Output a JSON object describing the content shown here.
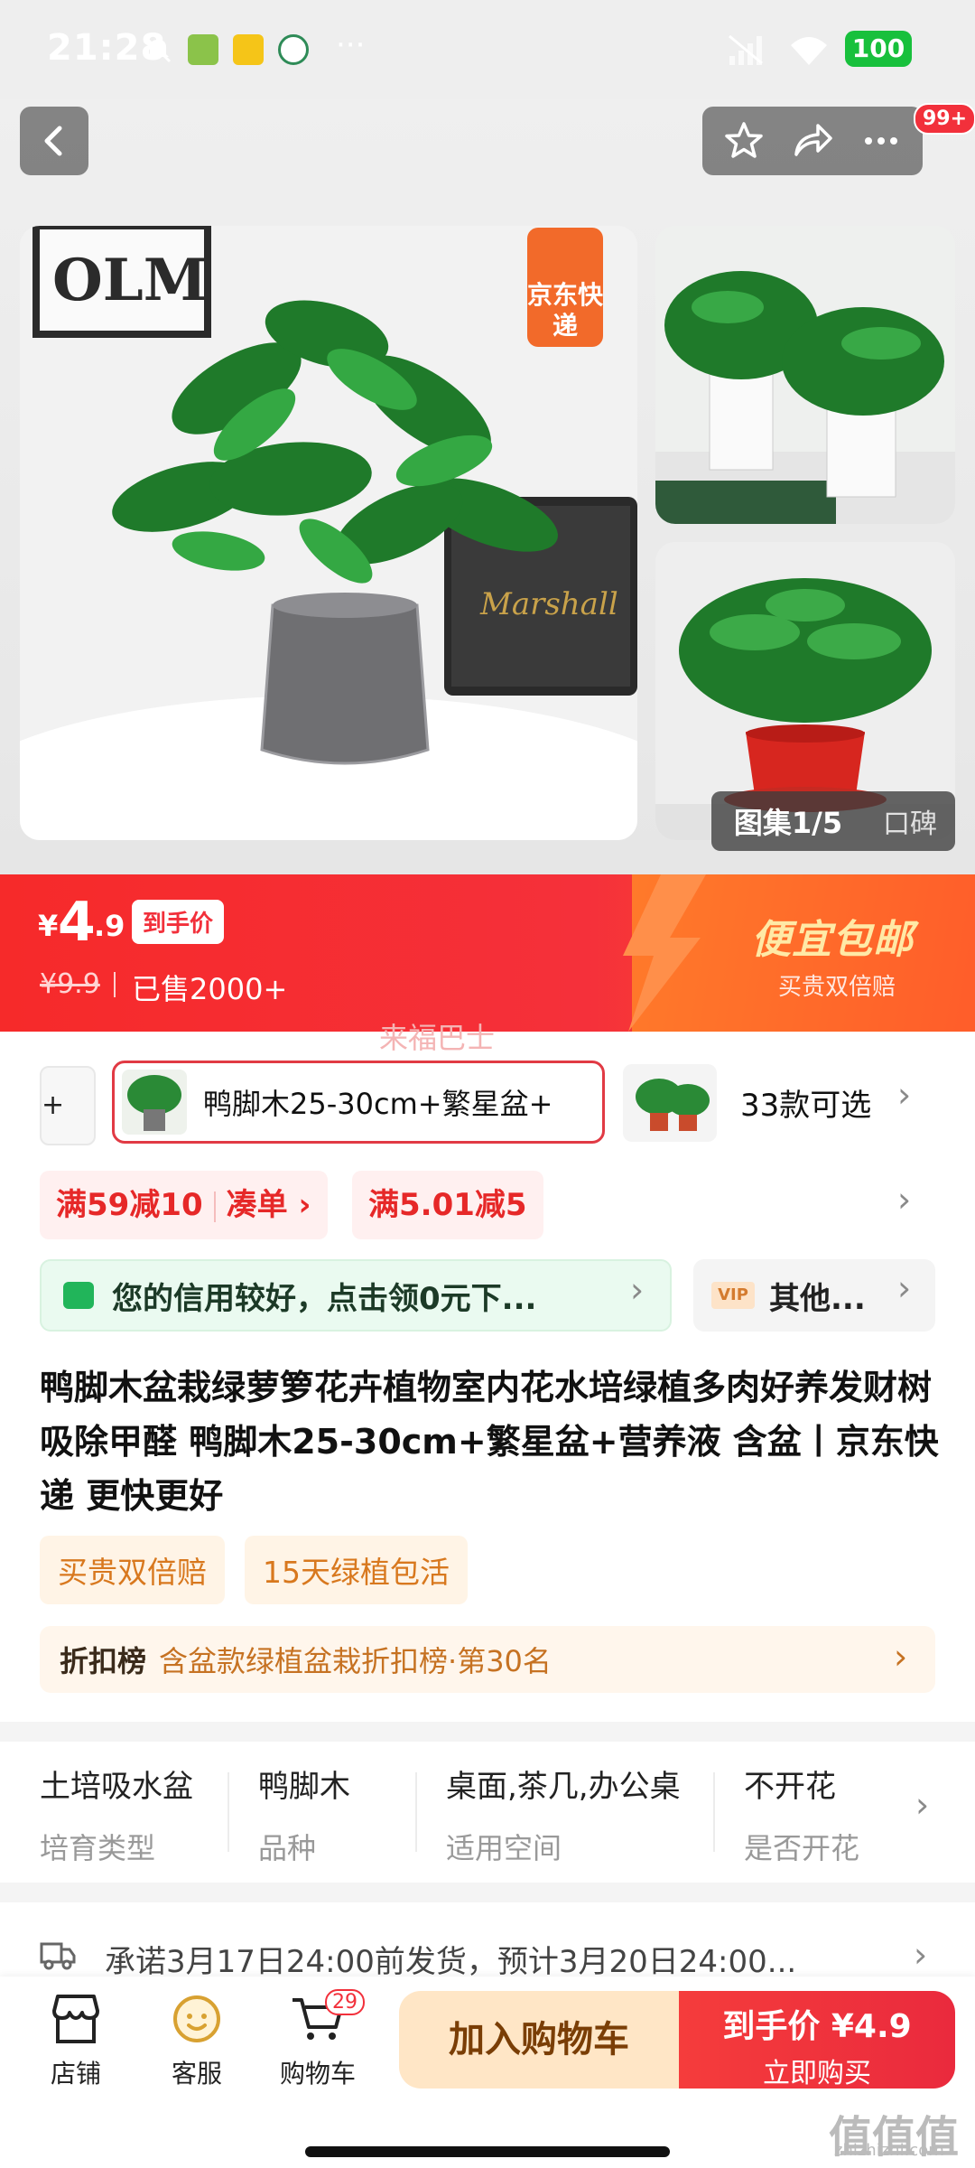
{
  "status_bar": {
    "time": "21:28",
    "battery": "100"
  },
  "header": {
    "badge": "99+"
  },
  "gallery": {
    "jd_tag": "京东快递",
    "counter": "图集1/5",
    "reviews_tab": "口碑"
  },
  "price": {
    "currency": "¥",
    "integer": "4",
    "decimal": ".9",
    "tag": "到手价",
    "original": "¥9.9",
    "sold": "已售2000+",
    "promo_title": "便宜包邮",
    "promo_sub": "买贵双倍赔",
    "ghost_text": "来福巴士"
  },
  "sku": {
    "left_partial": "盆+",
    "selected": "鸭脚木25-30cm+繁星盆+",
    "count": "33款可选"
  },
  "coupons": {
    "c1_main": "满59减10",
    "c1_action": "凑单 ›",
    "c2": "满5.01减5"
  },
  "credit": {
    "text": "您的信用较好，点击领0元下...",
    "vip": "VIP",
    "other": "其他..."
  },
  "title": "鸭脚木盆栽绿萝箩花卉植物室内花水培绿植多肉好养发财树吸除甲醛 鸭脚木25-30cm+繁星盆+营养液 含盆丨京东快递 更快更好",
  "tags": [
    "买贵双倍赔",
    "15天绿植包活"
  ],
  "rank": {
    "label": "折扣榜",
    "value": "含盆款绿植盆栽折扣榜·第30名"
  },
  "attributes": [
    {
      "value": "土培吸水盆",
      "key": "培育类型"
    },
    {
      "value": "鸭脚木",
      "key": "品种"
    },
    {
      "value": "桌面,茶几,办公桌",
      "key": "适用空间"
    },
    {
      "value": "不开花",
      "key": "是否开花"
    }
  ],
  "shipping": "承诺3月17日24:00前发货，预计3月20日24:00...",
  "bottom": {
    "shop": "店铺",
    "service": "客服",
    "cart": "购物车",
    "cart_count": "29",
    "add_cart": "加入购物车",
    "buy_line1": "到手价 ¥4.9",
    "buy_line2": "立即购买"
  },
  "watermark": "值值值",
  "watermark_url": "zhizhizhi.com",
  "colors": {
    "accent_red": "#f2303b",
    "promo_orange": "#ff6a2a",
    "credit_green": "#21b55a",
    "tag_orange": "#d8781e"
  }
}
